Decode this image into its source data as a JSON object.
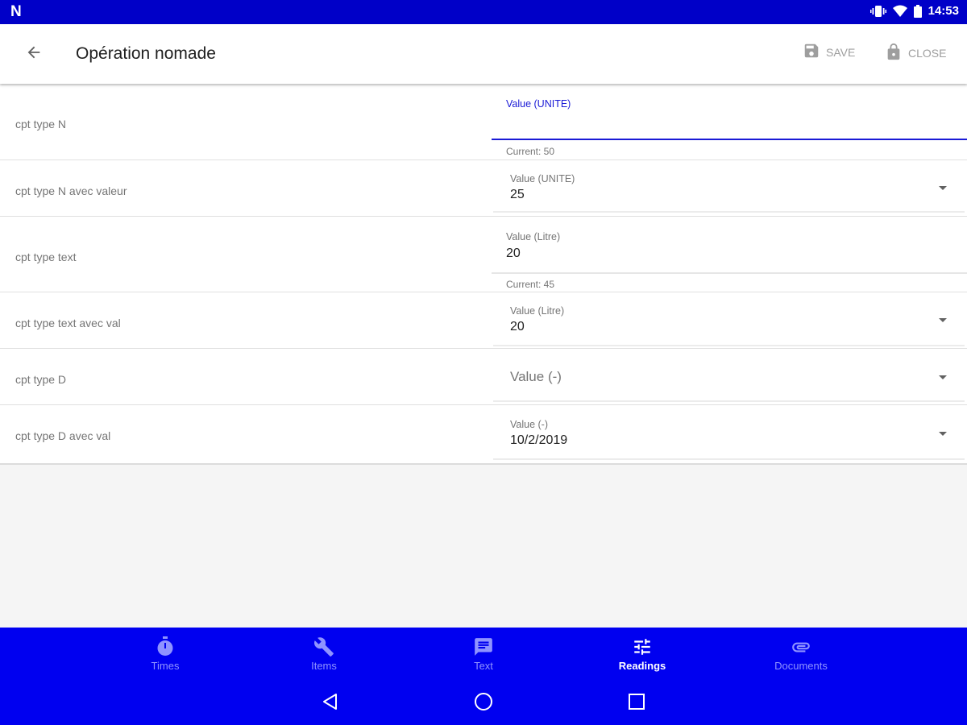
{
  "status_bar": {
    "logo": "N",
    "time": "14:53"
  },
  "app_bar": {
    "title": "Opération nomade",
    "save_label": "SAVE",
    "close_label": "CLOSE"
  },
  "rows": [
    {
      "label": "cpt type N",
      "field_label": "Value (UNITE)",
      "value": "",
      "helper": "Current: 50",
      "focused": true,
      "dropdown": false
    },
    {
      "label": "cpt type N avec valeur",
      "field_label": "Value (UNITE)",
      "value": "25",
      "helper": "",
      "dropdown": true
    },
    {
      "label": "cpt type text",
      "field_label": "Value (Litre)",
      "value": "20",
      "helper": "Current: 45",
      "dropdown": false
    },
    {
      "label": "cpt type text avec val",
      "field_label": "Value (Litre)",
      "value": "20",
      "helper": "",
      "dropdown": true
    },
    {
      "label": "cpt type D",
      "field_label": "",
      "value": "",
      "placeholder": "Value (-)",
      "helper": "",
      "dropdown": true
    },
    {
      "label": "cpt type D avec val",
      "field_label": "Value (-)",
      "value": "10/2/2019",
      "helper": "",
      "dropdown": true
    }
  ],
  "bottom_nav": {
    "active": "Readings",
    "items": [
      {
        "label": "Times",
        "icon": "timer-icon"
      },
      {
        "label": "Items",
        "icon": "wrench-icon"
      },
      {
        "label": "Text",
        "icon": "message-icon"
      },
      {
        "label": "Readings",
        "icon": "tune-icon"
      },
      {
        "label": "Documents",
        "icon": "attachment-icon"
      }
    ]
  },
  "colors": {
    "status_bar": "#0000c8",
    "nav_bar": "#0000f0",
    "accent": "#1a1ad6",
    "inactive_nav": "#8f93ff"
  }
}
